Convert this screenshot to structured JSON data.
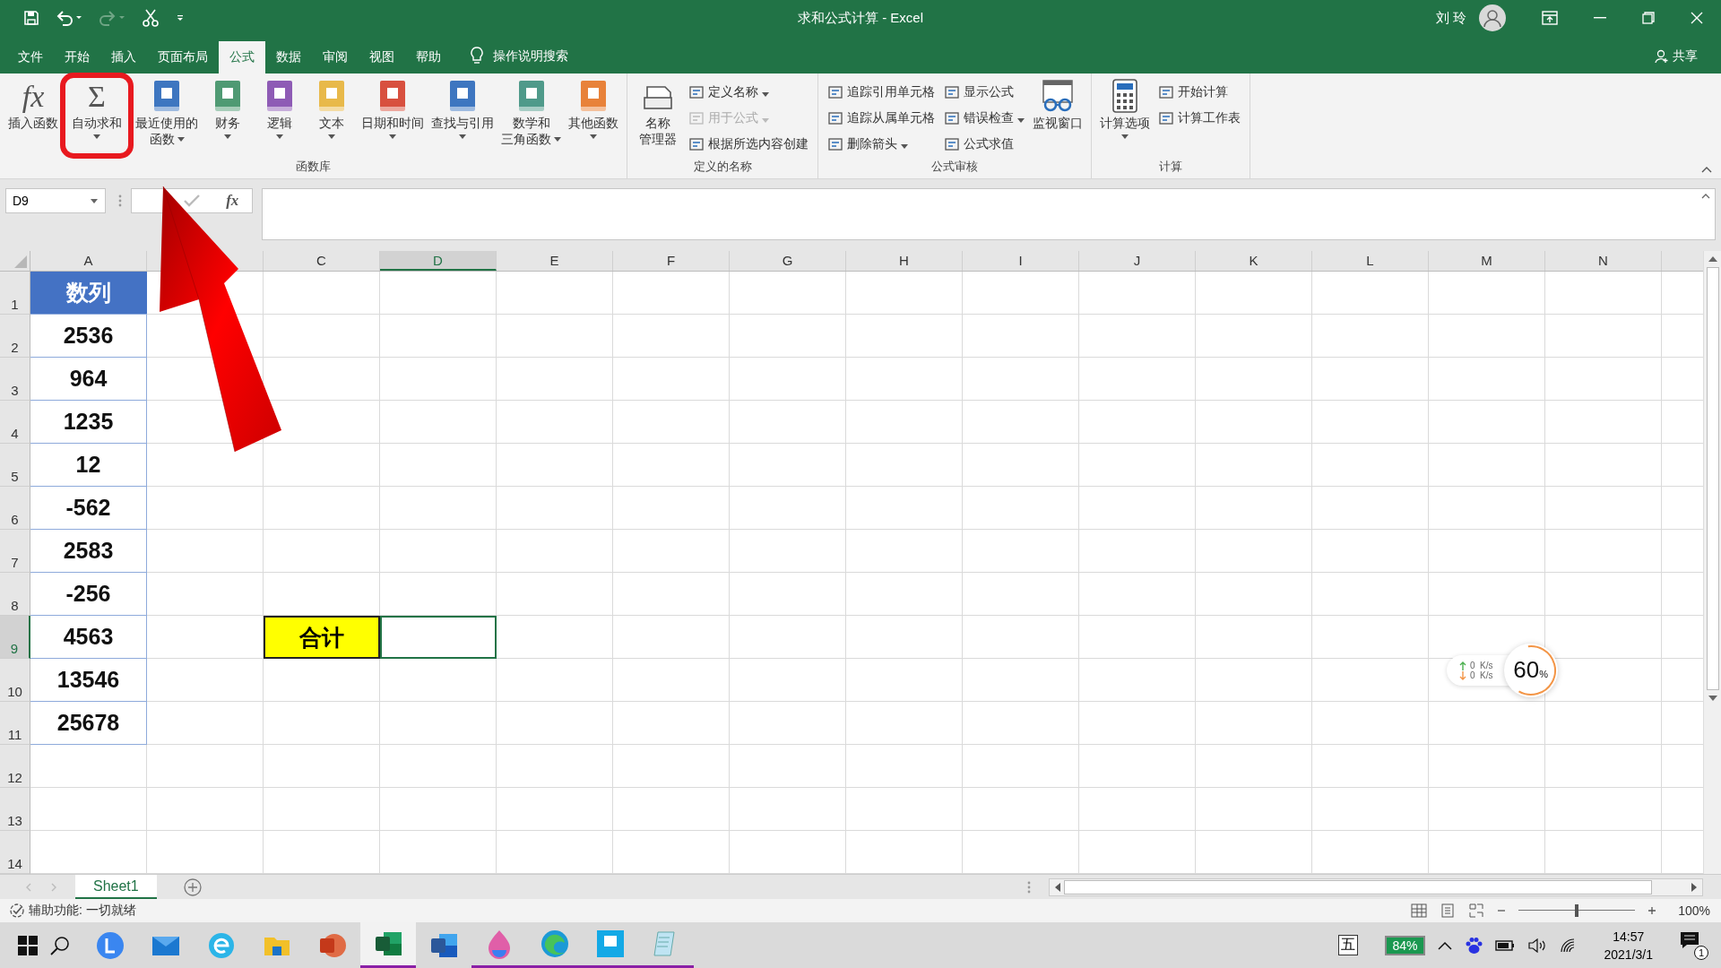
{
  "window": {
    "title": "求和公式计算 - Excel",
    "user": "刘 玲"
  },
  "menu_tabs": [
    {
      "label": "文件",
      "selected": false
    },
    {
      "label": "开始",
      "selected": false
    },
    {
      "label": "插入",
      "selected": false
    },
    {
      "label": "页面布局",
      "selected": false
    },
    {
      "label": "公式",
      "selected": true
    },
    {
      "label": "数据",
      "selected": false
    },
    {
      "label": "审阅",
      "selected": false
    },
    {
      "label": "视图",
      "selected": false
    },
    {
      "label": "帮助",
      "selected": false
    }
  ],
  "tell_me": "操作说明搜索",
  "share": "共享",
  "ribbon_groups": [
    {
      "label": "函数库",
      "items": [
        {
          "kind": "large",
          "glyph": "fx",
          "lines": [
            "插入函数"
          ],
          "dropdown": false,
          "highlighted": false
        },
        {
          "kind": "large",
          "glyph": "Σ",
          "lines": [
            "自动求和"
          ],
          "dropdown": true,
          "highlighted": true
        },
        {
          "kind": "large",
          "lines": [
            "最近使用的",
            "函数"
          ],
          "dropdown": true,
          "highlighted": false
        },
        {
          "kind": "large",
          "lines": [
            "财务"
          ],
          "dropdown": true,
          "highlighted": false
        },
        {
          "kind": "large",
          "lines": [
            "逻辑"
          ],
          "dropdown": true,
          "highlighted": false
        },
        {
          "kind": "large",
          "lines": [
            "文本"
          ],
          "dropdown": true,
          "highlighted": false
        },
        {
          "kind": "large",
          "lines": [
            "日期和时间"
          ],
          "dropdown": true,
          "highlighted": false
        },
        {
          "kind": "large",
          "lines": [
            "查找与引用"
          ],
          "dropdown": true,
          "highlighted": false
        },
        {
          "kind": "large",
          "lines": [
            "数学和",
            "三角函数"
          ],
          "dropdown": true,
          "highlighted": false
        },
        {
          "kind": "large",
          "lines": [
            "其他函数"
          ],
          "dropdown": true,
          "highlighted": false
        }
      ]
    },
    {
      "label": "定义的名称",
      "items": [
        {
          "kind": "large",
          "lines": [
            "名称",
            "管理器"
          ],
          "dropdown": false,
          "highlighted": false
        },
        {
          "kind": "stack",
          "items": [
            {
              "label": "定义名称",
              "dropdown": true,
              "disabled": false
            },
            {
              "label": "用于公式",
              "dropdown": true,
              "disabled": true
            },
            {
              "label": "根据所选内容创建",
              "dropdown": false,
              "disabled": false
            }
          ]
        }
      ]
    },
    {
      "label": "公式审核",
      "items": [
        {
          "kind": "stack",
          "items": [
            {
              "label": "追踪引用单元格",
              "dropdown": false,
              "disabled": false
            },
            {
              "label": "追踪从属单元格",
              "dropdown": false,
              "disabled": false
            },
            {
              "label": "删除箭头",
              "dropdown": true,
              "disabled": false
            }
          ]
        },
        {
          "kind": "stack",
          "items": [
            {
              "label": "显示公式",
              "dropdown": false,
              "disabled": false
            },
            {
              "label": "错误检查",
              "dropdown": true,
              "disabled": false
            },
            {
              "label": "公式求值",
              "dropdown": false,
              "disabled": false
            }
          ]
        },
        {
          "kind": "large",
          "lines": [
            "监视窗口"
          ],
          "dropdown": false,
          "highlighted": false
        }
      ]
    },
    {
      "label": "计算",
      "items": [
        {
          "kind": "large",
          "lines": [
            "计算选项"
          ],
          "dropdown": true,
          "highlighted": false
        },
        {
          "kind": "stack",
          "items": [
            {
              "label": "开始计算",
              "dropdown": false,
              "disabled": false
            },
            {
              "label": "计算工作表",
              "dropdown": false,
              "disabled": false
            }
          ]
        }
      ]
    }
  ],
  "name_box": "D9",
  "formula_fx": "fx",
  "columns": [
    {
      "kind": "letter",
      "label": "A",
      "selected": false
    },
    {
      "kind": "hidden"
    },
    {
      "kind": "letter",
      "label": "C",
      "selected": false
    },
    {
      "kind": "letter",
      "label": "D",
      "selected": true
    },
    {
      "kind": "letter",
      "label": "E",
      "selected": false
    },
    {
      "kind": "letter",
      "label": "F",
      "selected": false
    },
    {
      "kind": "letter",
      "label": "G",
      "selected": false
    },
    {
      "kind": "letter",
      "label": "H",
      "selected": false
    },
    {
      "kind": "letter",
      "label": "I",
      "selected": false
    },
    {
      "kind": "letter",
      "label": "J",
      "selected": false
    },
    {
      "kind": "letter",
      "label": "K",
      "selected": false
    },
    {
      "kind": "letter",
      "label": "L",
      "selected": false
    },
    {
      "kind": "letter",
      "label": "M",
      "selected": false
    },
    {
      "kind": "letter",
      "label": "N",
      "selected": false
    }
  ],
  "rows": [
    {
      "label": "1",
      "selected": false,
      "cells": [
        {
          "text": "数列",
          "kind": "header"
        }
      ]
    },
    {
      "label": "2",
      "selected": false,
      "cells": [
        {
          "text": "2536",
          "kind": "number"
        }
      ]
    },
    {
      "label": "3",
      "selected": false,
      "cells": [
        {
          "text": "964",
          "kind": "number"
        }
      ]
    },
    {
      "label": "4",
      "selected": false,
      "cells": [
        {
          "text": "1235",
          "kind": "number"
        }
      ]
    },
    {
      "label": "5",
      "selected": false,
      "cells": [
        {
          "text": "12",
          "kind": "number"
        }
      ]
    },
    {
      "label": "6",
      "selected": false,
      "cells": [
        {
          "text": "-562",
          "kind": "number"
        }
      ]
    },
    {
      "label": "7",
      "selected": false,
      "cells": [
        {
          "text": "2583",
          "kind": "number"
        }
      ]
    },
    {
      "label": "8",
      "selected": false,
      "cells": [
        {
          "text": "-256",
          "kind": "number"
        }
      ]
    },
    {
      "label": "9",
      "selected": true,
      "cells": [
        {
          "text": "4563",
          "kind": "number"
        },
        {
          "kind": "empty"
        },
        {
          "text": "合计",
          "kind": "highlight"
        }
      ]
    },
    {
      "label": "10",
      "selected": false,
      "cells": [
        {
          "text": "13546",
          "kind": "number"
        }
      ]
    },
    {
      "label": "11",
      "selected": false,
      "cells": [
        {
          "text": "25678",
          "kind": "number"
        }
      ]
    },
    {
      "label": "12",
      "selected": false
    },
    {
      "label": "13",
      "selected": false
    },
    {
      "label": "14",
      "selected": false
    }
  ],
  "sheet_tabs": [
    {
      "label": "Sheet1",
      "selected": true
    }
  ],
  "status": "辅助功能: 一切就绪",
  "zoom": {
    "value": "100%",
    "level": 0.5
  },
  "net_widget": {
    "up": "0",
    "up_unit": "K/s",
    "down": "0",
    "down_unit": "K/s",
    "value": "60",
    "unit": "%"
  },
  "taskbar": {
    "apps": [
      {
        "kind": "circle",
        "running": false,
        "active": false
      },
      {
        "kind": "mail",
        "running": false,
        "active": false
      },
      {
        "kind": "ring",
        "running": false,
        "active": false
      },
      {
        "kind": "folder",
        "running": false,
        "active": false
      },
      {
        "kind": "slides",
        "running": false,
        "active": false
      },
      {
        "kind": "sheet",
        "running": true,
        "active": true
      },
      {
        "kind": "doc",
        "running": false,
        "active": false
      },
      {
        "kind": "drop",
        "running": true,
        "active": false
      },
      {
        "kind": "swirl",
        "running": true,
        "active": false
      },
      {
        "kind": "screen",
        "running": true,
        "active": false
      },
      {
        "kind": "notepad",
        "running": true,
        "active": false
      }
    ],
    "ime": "五",
    "battery": "84%",
    "time": "14:57",
    "date": "2021/3/1",
    "notifications": "1"
  }
}
